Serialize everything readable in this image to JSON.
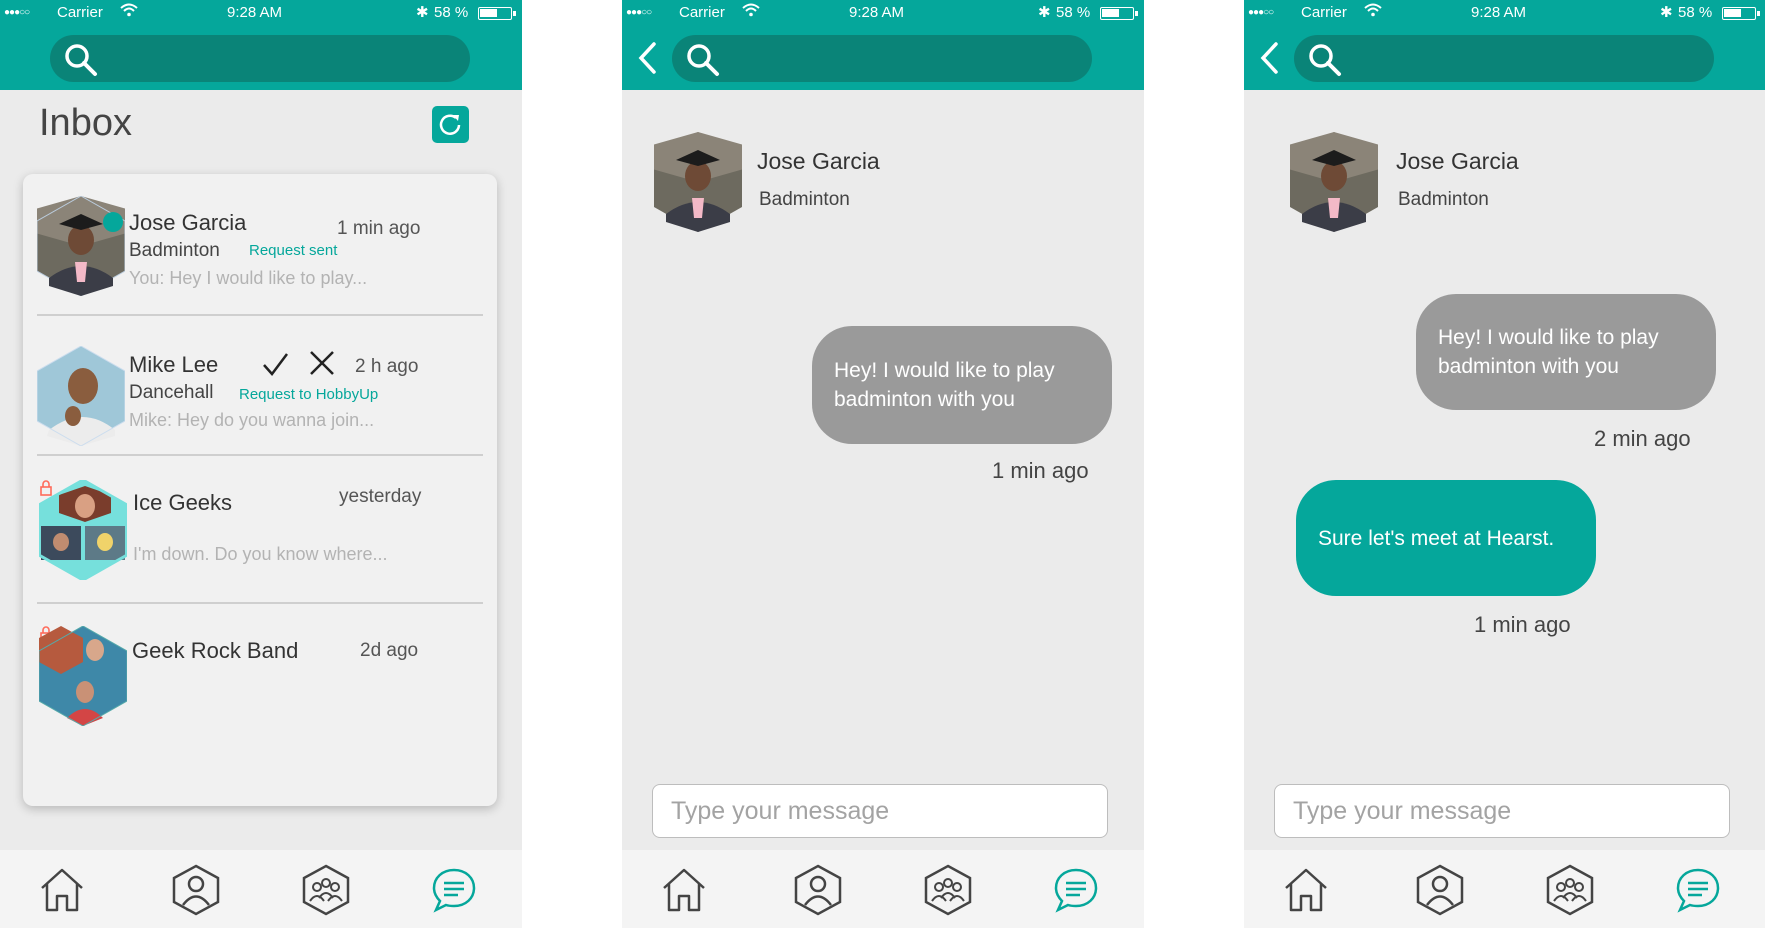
{
  "status": {
    "carrier": "Carrier",
    "time": "9:28 AM",
    "battery": "58 %"
  },
  "colors": {
    "accent": "#05a79b",
    "accent_dark": "#0a8478",
    "bubble_gray": "#9a9a9a"
  },
  "inbox": {
    "title": "Inbox",
    "conversations": [
      {
        "name": "Jose Garcia",
        "activity": "Badminton",
        "tag": "Request sent",
        "preview": "You: Hey I would like to play...",
        "time": "1 min ago"
      },
      {
        "name": "Mike Lee",
        "activity": "Dancehall",
        "tag": "Request to HobbyUp",
        "preview": "Mike: Hey do you wanna join...",
        "time": "2 h ago"
      },
      {
        "name": "Ice Geeks",
        "preview": "I'm down. Do you know where...",
        "time": "yesterday"
      },
      {
        "name": "Geek Rock Band",
        "time": "2d ago"
      }
    ]
  },
  "chat1": {
    "contact": {
      "name": "Jose Garcia",
      "activity": "Badminton"
    },
    "messages": [
      {
        "text": "Hey! I would like to play badminton with you",
        "time": "1 min ago"
      }
    ],
    "input_placeholder": "Type your message"
  },
  "chat2": {
    "contact": {
      "name": "Jose Garcia",
      "activity": "Badminton"
    },
    "messages": [
      {
        "text": "Hey! I would like to play badminton with you",
        "time": "2 min ago"
      },
      {
        "text": "Sure let's meet at Hearst.",
        "time": "1 min ago"
      }
    ],
    "input_placeholder": "Type your message"
  },
  "tabbar": {
    "icons": [
      "home-icon",
      "profile-icon",
      "groups-icon",
      "chat-icon"
    ],
    "active": "chat-icon"
  }
}
